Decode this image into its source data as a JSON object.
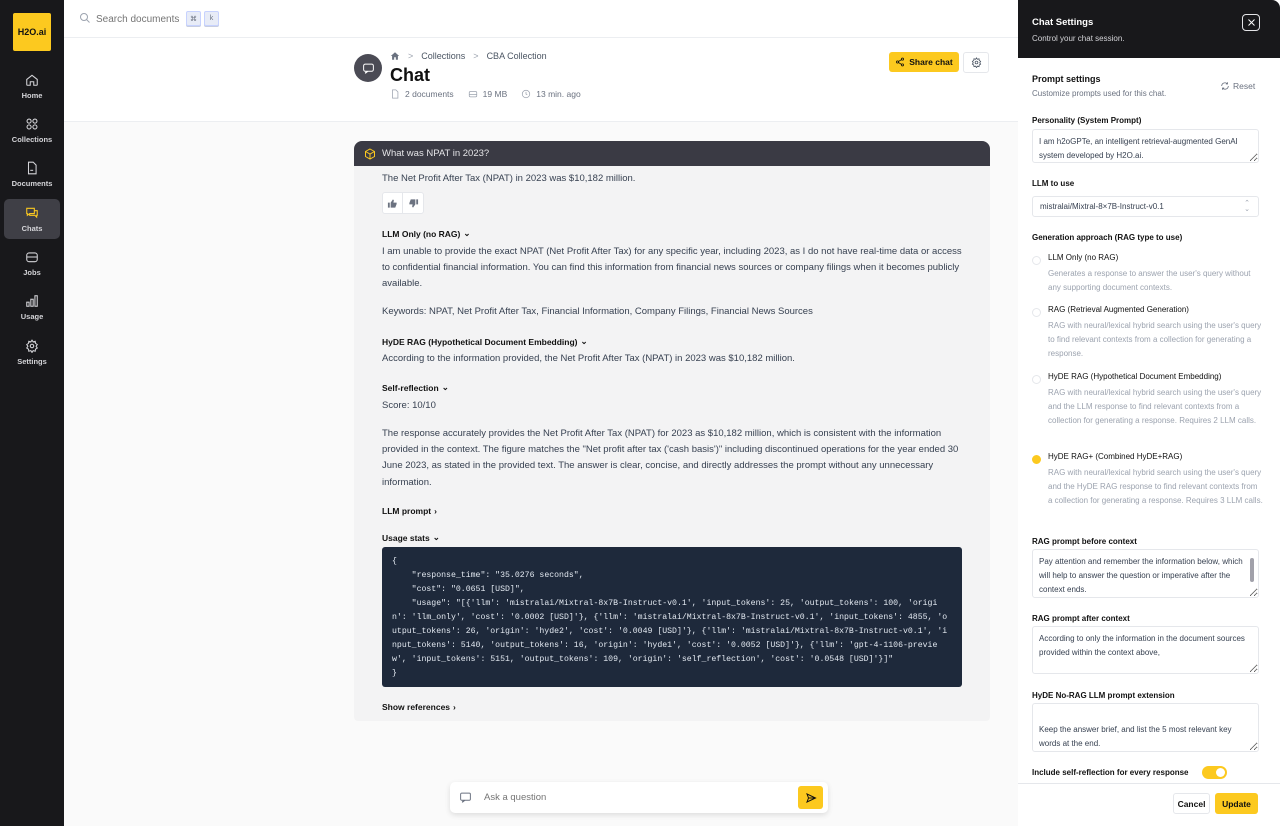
{
  "app": {
    "logo": "H2O.ai"
  },
  "sidebar": {
    "items": [
      {
        "label": "Home",
        "icon": "home-icon"
      },
      {
        "label": "Collections",
        "icon": "grid-icon"
      },
      {
        "label": "Documents",
        "icon": "document-icon"
      },
      {
        "label": "Chats",
        "icon": "chat-icon",
        "active": true
      },
      {
        "label": "Jobs",
        "icon": "jobs-icon"
      },
      {
        "label": "Usage",
        "icon": "bar-chart-icon"
      },
      {
        "label": "Settings",
        "icon": "gear-icon"
      }
    ]
  },
  "topbar": {
    "search_placeholder": "Search documents",
    "shortcut_keys": [
      "⌘",
      "k"
    ]
  },
  "header": {
    "breadcrumb": [
      "Collections",
      "CBA Collection"
    ],
    "title": "Chat",
    "meta": {
      "documents": "2 documents",
      "size": "19 MB",
      "time": "13 min. ago"
    },
    "share_label": "Share chat"
  },
  "chat": {
    "question": "What was NPAT in 2023?",
    "answer": "The Net Profit After Tax (NPAT) in 2023 was $10,182 million.",
    "sections": {
      "llm_only": {
        "title": "LLM Only (no RAG)",
        "text": "I am unable to provide the exact NPAT (Net Profit After Tax) for any specific year, including 2023, as I do not have real-time data or access to confidential financial information. You can find this information from financial news sources or company filings when it becomes publicly available.",
        "keywords": "Keywords: NPAT, Net Profit After Tax, Financial Information, Company Filings, Financial News Sources"
      },
      "hyde": {
        "title": "HyDE RAG (Hypothetical Document Embedding)",
        "text": "According to the information provided, the Net Profit After Tax (NPAT) in 2023 was $10,182 million."
      },
      "self_reflection": {
        "title": "Self-reflection",
        "score": "Score: 10/10",
        "text": "The response accurately provides the Net Profit After Tax (NPAT) for 2023 as $10,182 million, which is consistent with the information provided in the context. The figure matches the \"Net profit after tax ('cash basis')\" including discontinued operations for the year ended 30 June 2023, as stated in the provided text. The answer is clear, concise, and directly addresses the prompt without any unnecessary information."
      },
      "llm_prompt": {
        "title": "LLM prompt"
      },
      "usage_stats": {
        "title": "Usage stats",
        "code": "{\n    \"response_time\": \"35.0276 seconds\",\n    \"cost\": \"0.0651 [USD]\",\n    \"usage\": \"[{'llm': 'mistralai/Mixtral-8x7B-Instruct-v0.1', 'input_tokens': 25, 'output_tokens': 100, 'origin': 'llm_only', 'cost': '0.0002 [USD]'}, {'llm': 'mistralai/Mixtral-8x7B-Instruct-v0.1', 'input_tokens': 4855, 'output_tokens': 26, 'origin': 'hyde2', 'cost': '0.0049 [USD]'}, {'llm': 'mistralai/Mixtral-8x7B-Instruct-v0.1', 'input_tokens': 5140, 'output_tokens': 16, 'origin': 'hyde1', 'cost': '0.0052 [USD]'}, {'llm': 'gpt-4-1106-preview', 'input_tokens': 5151, 'output_tokens': 109, 'origin': 'self_reflection', 'cost': '0.0548 [USD]'}]\"\n}"
      },
      "show_references": {
        "title": "Show references"
      }
    },
    "ask_placeholder": "Ask a question"
  },
  "settings": {
    "title": "Chat Settings",
    "subtitle": "Control your chat session.",
    "prompt_settings": {
      "title": "Prompt settings",
      "subtitle": "Customize prompts used for this chat.",
      "reset_label": "Reset"
    },
    "personality": {
      "label": "Personality (System Prompt)",
      "value": "I am h2oGPTe, an intelligent retrieval-augmented GenAI system developed by H2O.ai."
    },
    "llm": {
      "label": "LLM to use",
      "value": "mistralai/Mixtral-8×7B-Instruct-v0.1"
    },
    "generation": {
      "label": "Generation approach (RAG type to use)",
      "options": [
        {
          "title": "LLM Only (no RAG)",
          "desc": "Generates a response to answer the user's query without any supporting document contexts.",
          "selected": false
        },
        {
          "title": "RAG (Retrieval Augmented Generation)",
          "desc": "RAG with neural/lexical hybrid search using the user's query to find relevant contexts from a collection for generating a response.",
          "selected": false
        },
        {
          "title": "HyDE RAG (Hypothetical Document Embedding)",
          "desc": "RAG with neural/lexical hybrid search using the user's query and the LLM response to find relevant contexts from a collection for generating a response. Requires 2 LLM calls.",
          "selected": false
        },
        {
          "title": "HyDE RAG+ (Combined HyDE+RAG)",
          "desc": "RAG with neural/lexical hybrid search using the user's query and the HyDE RAG response to find relevant contexts from a collection for generating a response. Requires 3 LLM calls.",
          "selected": true
        }
      ]
    },
    "rag_before": {
      "label": "RAG prompt before context",
      "value": "Pay attention and remember the information below, which will help to answer the question or imperative after the context ends."
    },
    "rag_after": {
      "label": "RAG prompt after context",
      "value": "According to only the information in the document sources provided within the context above,"
    },
    "hyde_ext": {
      "label": "HyDE No-RAG LLM prompt extension",
      "value": "\nKeep the answer brief, and list the 5 most relevant key words at the end."
    },
    "self_reflection": {
      "label": "Include self-reflection for every response",
      "enabled": true
    },
    "cancel_label": "Cancel",
    "update_label": "Update"
  }
}
